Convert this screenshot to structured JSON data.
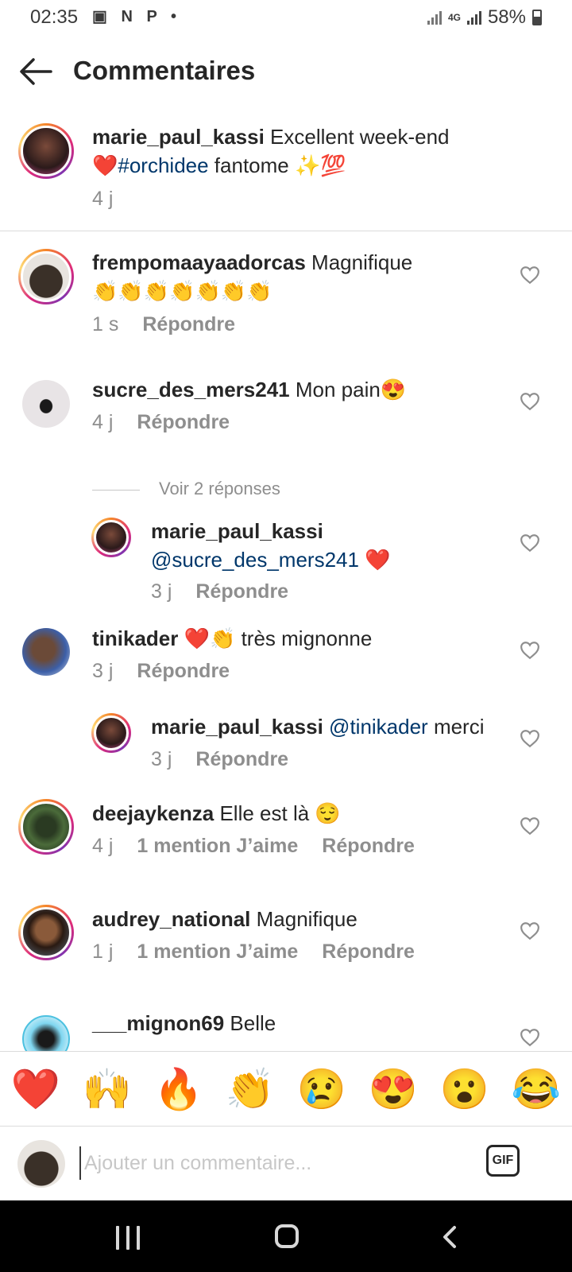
{
  "status_bar": {
    "time": "02:35",
    "left_icons": "▣ N P •",
    "network": "4G",
    "battery": "58%"
  },
  "header": {
    "title": "Commentaires"
  },
  "caption": {
    "username": "marie_paul_kassi",
    "text_before": "Excellent week-end",
    "emoji1": "❤️",
    "hashtag": "#orchidee",
    "text_after": " fantome ✨💯",
    "time": "4 j"
  },
  "comments": [
    {
      "username": "frempomaayaadorcas",
      "text": "Magnifique 👏👏👏👏👏👏👏",
      "time": "1 s",
      "reply": "Répondre"
    },
    {
      "username": "sucre_des_mers241",
      "text": "Mon pain😍",
      "time": "4 j",
      "reply": "Répondre"
    },
    {
      "username": "tinikader",
      "text": "❤️👏 très mignonne",
      "time": "3 j",
      "reply": "Répondre"
    },
    {
      "username": "deejaykenza",
      "text": "Elle est là 😌",
      "time": "4 j",
      "likes": "1 mention J’aime",
      "reply": "Répondre"
    },
    {
      "username": "audrey_national",
      "text": "Magnifique",
      "time": "1 j",
      "likes": "1 mention J’aime",
      "reply": "Répondre"
    },
    {
      "username": "___mignon69",
      "text": "Belle"
    }
  ],
  "replies_toggle": "Voir 2 réponses",
  "replies": [
    {
      "username": "marie_paul_kassi",
      "mention": "@sucre_des_mers241",
      "text": " ❤️",
      "time": "3 j",
      "reply": "Répondre"
    },
    {
      "username": "marie_paul_kassi",
      "mention": "@tinikader",
      "text": " merci",
      "time": "3 j",
      "reply": "Répondre"
    }
  ],
  "emoji_bar": [
    "❤️",
    "🙌",
    "🔥",
    "👏",
    "😢",
    "😍",
    "😮",
    "😂"
  ],
  "input": {
    "placeholder": "Ajouter un commentaire...",
    "gif_label": "GIF"
  },
  "colors": {
    "link": "#00376b",
    "muted": "#8e8e8e",
    "text": "#262626",
    "divider": "#dbdbdb"
  }
}
